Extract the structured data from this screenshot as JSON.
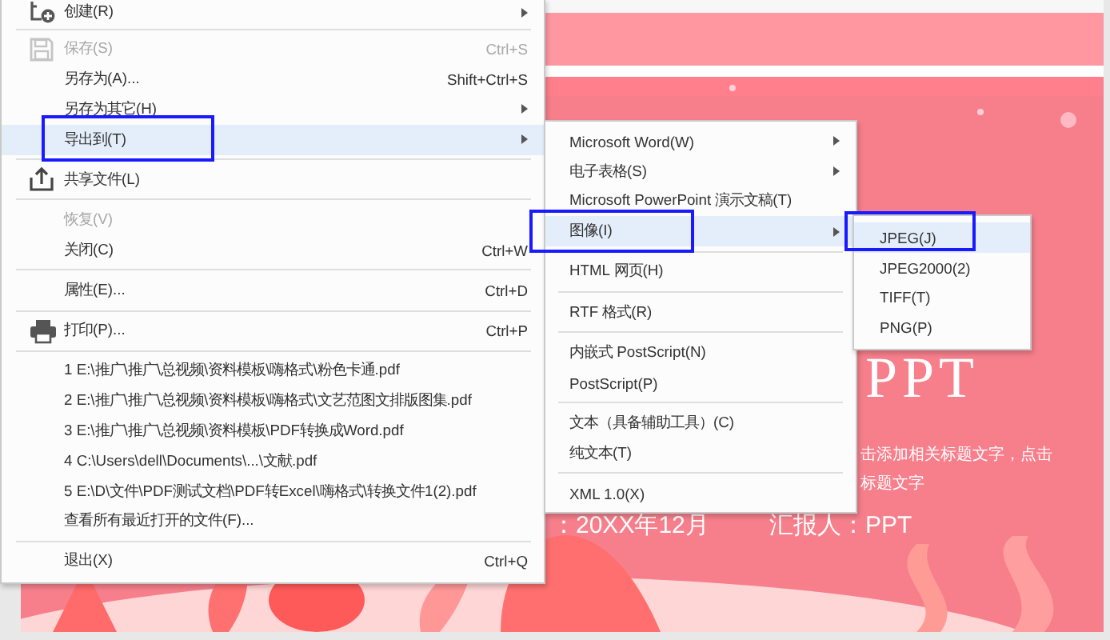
{
  "menu": {
    "items": [
      {
        "kind": "item",
        "label": "创建(R)",
        "has_submenu": true,
        "disabled": false,
        "selected": false,
        "outlined": false
      },
      {
        "kind": "separator"
      },
      {
        "kind": "item",
        "label": "保存(S)",
        "shortcut": "Ctrl+S",
        "has_submenu": false,
        "disabled": true,
        "selected": false,
        "outlined": false
      },
      {
        "kind": "item",
        "label": "另存为(A)...",
        "shortcut": "Shift+Ctrl+S",
        "has_submenu": false,
        "disabled": false,
        "selected": false,
        "outlined": false
      },
      {
        "kind": "item",
        "label": "另存为其它(H)",
        "has_submenu": true,
        "disabled": false,
        "selected": false,
        "outlined": false
      },
      {
        "kind": "item",
        "label": "导出到(T)",
        "has_submenu": true,
        "disabled": false,
        "selected": true,
        "outlined": true
      },
      {
        "kind": "separator"
      },
      {
        "kind": "item",
        "label": "共享文件(L)",
        "has_submenu": false,
        "disabled": false,
        "selected": false,
        "outlined": false
      },
      {
        "kind": "separator"
      },
      {
        "kind": "item",
        "label": "恢复(V)",
        "has_submenu": false,
        "disabled": true,
        "selected": false,
        "outlined": false
      },
      {
        "kind": "item",
        "label": "关闭(C)",
        "shortcut": "Ctrl+W",
        "has_submenu": false,
        "disabled": false,
        "selected": false,
        "outlined": false
      },
      {
        "kind": "separator"
      },
      {
        "kind": "item",
        "label": "属性(E)...",
        "shortcut": "Ctrl+D",
        "has_submenu": false,
        "disabled": false,
        "selected": false,
        "outlined": false
      },
      {
        "kind": "separator"
      },
      {
        "kind": "item",
        "label": "打印(P)...",
        "shortcut": "Ctrl+P",
        "has_submenu": false,
        "disabled": false,
        "selected": false,
        "outlined": false
      },
      {
        "kind": "separator"
      },
      {
        "kind": "item",
        "label": "1 E:\\推广\\推广\\总视频\\资料模板\\嗨格式\\粉色卡通.pdf",
        "has_submenu": false,
        "disabled": false,
        "selected": false,
        "outlined": false
      },
      {
        "kind": "item",
        "label": "2 E:\\推广\\推广\\总视频\\资料模板\\嗨格式\\文艺范图文排版图集.pdf",
        "has_submenu": false,
        "disabled": false,
        "selected": false,
        "outlined": false
      },
      {
        "kind": "item",
        "label": "3 E:\\推广\\推广\\总视频\\资料模板\\PDF转换成Word.pdf",
        "has_submenu": false,
        "disabled": false,
        "selected": false,
        "outlined": false
      },
      {
        "kind": "item",
        "label": "4 C:\\Users\\dell\\Documents\\...\\文献.pdf",
        "has_submenu": false,
        "disabled": false,
        "selected": false,
        "outlined": false
      },
      {
        "kind": "item",
        "label": "5 E:\\D\\文件\\PDF测试文档\\PDF转Excel\\嗨格式\\转换文件1(2).pdf",
        "has_submenu": false,
        "disabled": false,
        "selected": false,
        "outlined": false
      },
      {
        "kind": "item",
        "label": "查看所有最近打开的文件(F)...",
        "has_submenu": false,
        "disabled": false,
        "selected": false,
        "outlined": false
      },
      {
        "kind": "separator"
      },
      {
        "kind": "item",
        "label": "退出(X)",
        "shortcut": "Ctrl+Q",
        "has_submenu": false,
        "disabled": false,
        "selected": false,
        "outlined": false
      }
    ]
  },
  "export_submenu": {
    "items": [
      {
        "kind": "item",
        "label": "Microsoft Word(W)",
        "has_submenu": true,
        "disabled": false,
        "selected": false,
        "outlined": false
      },
      {
        "kind": "item",
        "label": "电子表格(S)",
        "has_submenu": true,
        "disabled": false,
        "selected": false,
        "outlined": false
      },
      {
        "kind": "item",
        "label": "Microsoft PowerPoint 演示文稿(T)",
        "has_submenu": false,
        "disabled": false,
        "selected": false,
        "outlined": false
      },
      {
        "kind": "item",
        "label": "图像(I)",
        "has_submenu": true,
        "disabled": false,
        "selected": true,
        "outlined": true
      },
      {
        "kind": "separator"
      },
      {
        "kind": "item",
        "label": "HTML 网页(H)",
        "has_submenu": false,
        "disabled": false,
        "selected": false,
        "outlined": false
      },
      {
        "kind": "separator"
      },
      {
        "kind": "item",
        "label": "RTF 格式(R)",
        "has_submenu": false,
        "disabled": false,
        "selected": false,
        "outlined": false
      },
      {
        "kind": "separator"
      },
      {
        "kind": "item",
        "label": "内嵌式 PostScript(N)",
        "has_submenu": false,
        "disabled": false,
        "selected": false,
        "outlined": false
      },
      {
        "kind": "item",
        "label": "PostScript(P)",
        "has_submenu": false,
        "disabled": false,
        "selected": false,
        "outlined": false
      },
      {
        "kind": "separator"
      },
      {
        "kind": "item",
        "label": "文本（具备辅助工具）(C)",
        "has_submenu": false,
        "disabled": false,
        "selected": false,
        "outlined": false
      },
      {
        "kind": "item",
        "label": "纯文本(T)",
        "has_submenu": false,
        "disabled": false,
        "selected": false,
        "outlined": false
      },
      {
        "kind": "separator"
      },
      {
        "kind": "item",
        "label": "XML 1.0(X)",
        "has_submenu": false,
        "disabled": false,
        "selected": false,
        "outlined": false
      }
    ]
  },
  "image_submenu": {
    "items": [
      {
        "kind": "item",
        "label": "JPEG(J)",
        "has_submenu": false,
        "disabled": false,
        "selected": true,
        "outlined": true
      },
      {
        "kind": "item",
        "label": "JPEG2000(2)",
        "has_submenu": false,
        "disabled": false,
        "selected": false,
        "outlined": false
      },
      {
        "kind": "item",
        "label": "TIFF(T)",
        "has_submenu": false,
        "disabled": false,
        "selected": false,
        "outlined": false
      },
      {
        "kind": "item",
        "label": "PNG(P)",
        "has_submenu": false,
        "disabled": false,
        "selected": false,
        "outlined": false
      }
    ]
  },
  "slide": {
    "title": "PPT",
    "subtitle_lines": [
      "击添加相关标题文字，点击",
      "标题文字"
    ],
    "date": "：20XX年12月",
    "reporter": "汇报人：PPT"
  }
}
